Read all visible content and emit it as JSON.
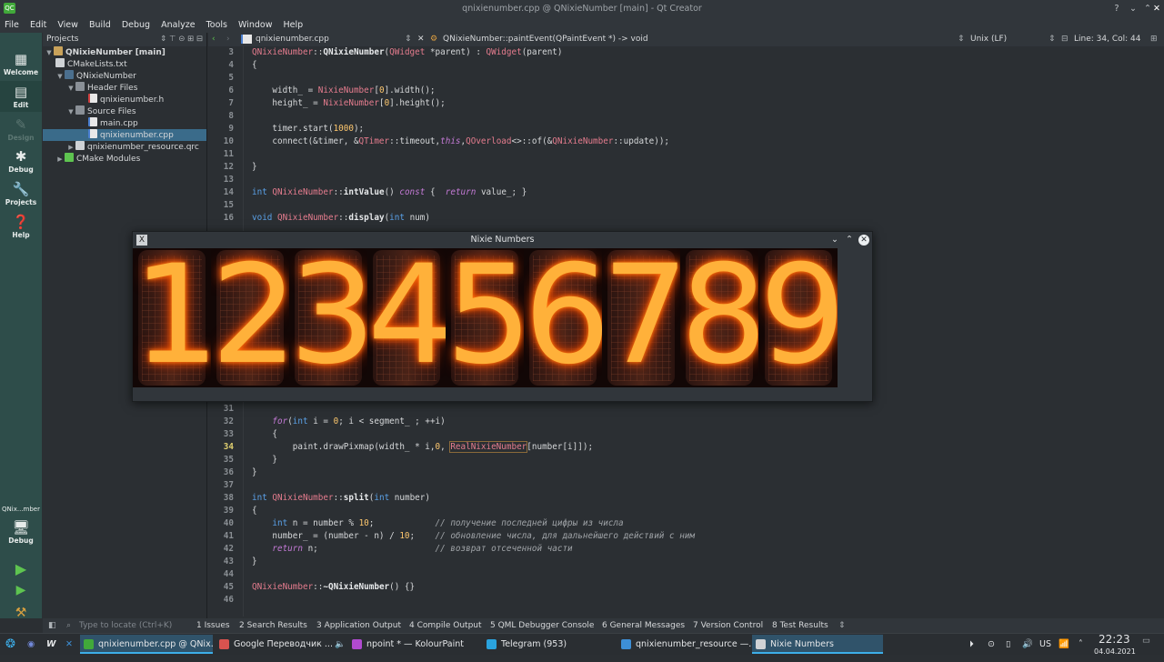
{
  "window": {
    "title": "qnixienumber.cpp @ QNixieNumber [main] - Qt Creator",
    "app_icon": "QC"
  },
  "menu": [
    "File",
    "Edit",
    "View",
    "Build",
    "Debug",
    "Analyze",
    "Tools",
    "Window",
    "Help"
  ],
  "modes": {
    "welcome": "Welcome",
    "edit": "Edit",
    "design": "Design",
    "debug": "Debug",
    "projects": "Projects",
    "help": "Help",
    "kit_target": "QNix...mber",
    "kit_mode": "Debug"
  },
  "sidebar": {
    "title": "Projects",
    "tree": [
      {
        "label": "QNixieNumber [main]",
        "bold": true
      },
      {
        "label": "CMakeLists.txt"
      },
      {
        "label": "QNixieNumber"
      },
      {
        "label": "Header Files"
      },
      {
        "label": "qnixienumber.h"
      },
      {
        "label": "Source Files"
      },
      {
        "label": "main.cpp"
      },
      {
        "label": "qnixienumber.cpp"
      },
      {
        "label": "qnixienumber_resource.qrc"
      },
      {
        "label": "CMake Modules"
      }
    ]
  },
  "editor": {
    "file": "qnixienumber.cpp",
    "symbol": "QNixieNumber::paintEvent(QPaintEvent *) -> void",
    "line_ending": "Unix (LF)",
    "position": "Line: 34, Col: 44"
  },
  "code_top": [
    {
      "n": "3",
      "t": "QNixieNumber::QNixieNumber(QWidget *parent) : QWidget(parent)"
    },
    {
      "n": "4",
      "t": "{"
    },
    {
      "n": "5",
      "t": ""
    },
    {
      "n": "6",
      "t": "    width_ = NixieNumber[0].width();"
    },
    {
      "n": "7",
      "t": "    height_ = NixieNumber[0].height();"
    },
    {
      "n": "8",
      "t": ""
    },
    {
      "n": "9",
      "t": "    timer.start(1000);"
    },
    {
      "n": "10",
      "t": "    connect(&timer, &QTimer::timeout,this,QOverload<>::of(&QNixieNumber::update));"
    },
    {
      "n": "11",
      "t": ""
    },
    {
      "n": "12",
      "t": "}"
    },
    {
      "n": "13",
      "t": ""
    },
    {
      "n": "14",
      "t": "int QNixieNumber::intValue() const {  return value_; }"
    },
    {
      "n": "15",
      "t": ""
    },
    {
      "n": "16",
      "t": "void QNixieNumber::display(int num)"
    }
  ],
  "code_bottom": [
    {
      "n": "31",
      "t": ""
    },
    {
      "n": "32",
      "t": "    for(int i = 0; i < segment_ ; ++i)"
    },
    {
      "n": "33",
      "t": "    {"
    },
    {
      "n": "34",
      "t": "        paint.drawPixmap(width_ * i,0, RealNixieNumber[number[i]]);"
    },
    {
      "n": "35",
      "t": "    }"
    },
    {
      "n": "36",
      "t": "}"
    },
    {
      "n": "37",
      "t": ""
    },
    {
      "n": "38",
      "t": "int QNixieNumber::split(int number)"
    },
    {
      "n": "39",
      "t": "{"
    },
    {
      "n": "40",
      "t": "    int n = number % 10;            // получение последней цифры из числа"
    },
    {
      "n": "41",
      "t": "    number_ = (number - n) / 10;    // обновление числа, для дальнейшего действий с ним"
    },
    {
      "n": "42",
      "t": "    return n;                       // возврат отсеченной части"
    },
    {
      "n": "43",
      "t": "}"
    },
    {
      "n": "44",
      "t": ""
    },
    {
      "n": "45",
      "t": "QNixieNumber::~QNixieNumber() {}"
    },
    {
      "n": "46",
      "t": ""
    }
  ],
  "nixie_window": {
    "title": "Nixie Numbers",
    "digits": [
      "1",
      "2",
      "3",
      "4",
      "5",
      "6",
      "7",
      "8",
      "9"
    ]
  },
  "bottom_panes": {
    "locator_placeholder": "Type to locate (Ctrl+K)",
    "tabs": [
      "1 Issues",
      "2 Search Results",
      "3 Application Output",
      "4 Compile Output",
      "5 QML Debugger Console",
      "6 General Messages",
      "7 Version Control",
      "8 Test Results"
    ]
  },
  "taskbar": {
    "tasks": [
      {
        "label": "qnixienumber.cpp @ QNix...",
        "color": "#41a93a"
      },
      {
        "label": "Google Переводчик ...",
        "color": "#d9534f"
      },
      {
        "label": "npoint * — KolourPaint",
        "color": "#b04ad0"
      },
      {
        "label": "Telegram (953)",
        "color": "#2aa3de"
      },
      {
        "label": "qnixienumber_resource —...",
        "color": "#3d8fd6"
      },
      {
        "label": "Nixie Numbers",
        "color": "#cfd2d5"
      }
    ],
    "keyboard_layout": "US",
    "time": "22:23",
    "date": "04.04.2021"
  },
  "colors": {
    "accent": "#3daee9",
    "mode_bar": "#2e4d4a",
    "run_green": "#5ec450"
  }
}
